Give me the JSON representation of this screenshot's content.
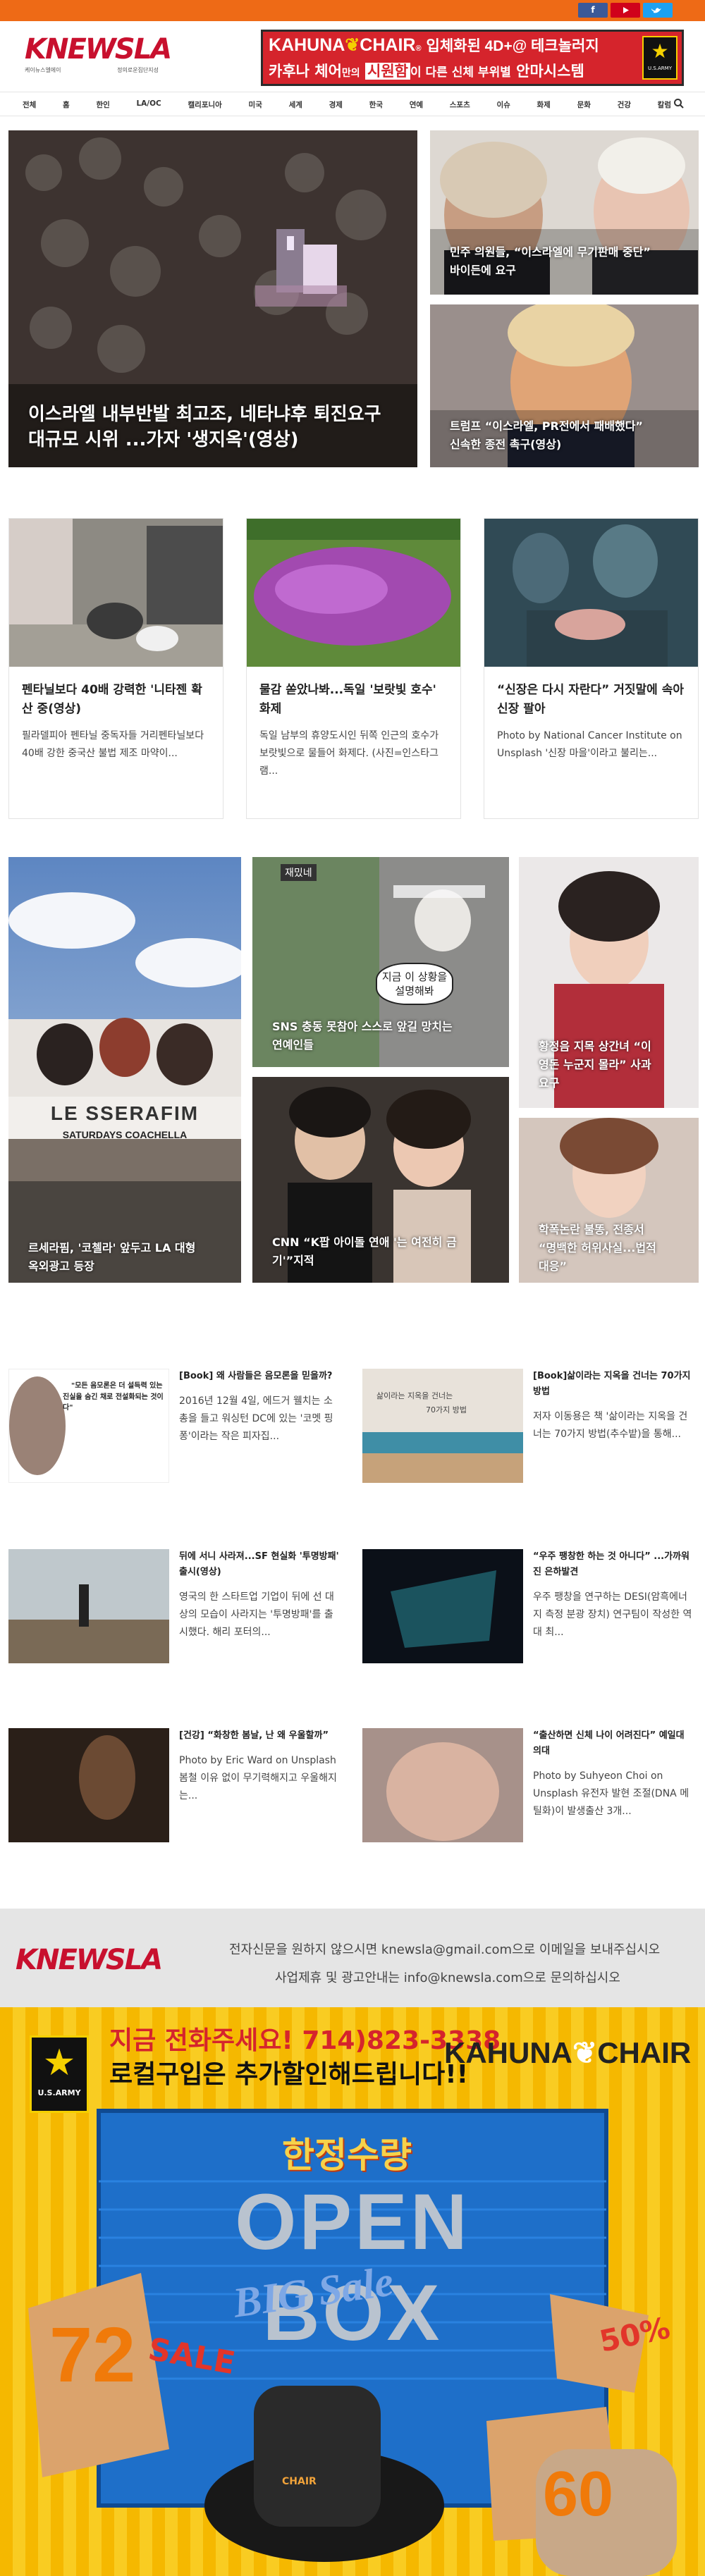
{
  "header": {
    "logo_text": "KNEWSLA",
    "logo_sub_left": "케이뉴스엘에이",
    "logo_sub_right": "정의로운집단지성",
    "ad": {
      "brand": "KAHUNA",
      "brand2": "CHAIR",
      "line1_tail": "입체화된 4D+@ 테크놀러지",
      "line2_a": "카후나 체어",
      "line2_b": "만의",
      "line2_c": "시원함",
      "line2_d": "이 다른 신체 부위별",
      "line2_e": "안마시스템",
      "army": "U.S.ARMY"
    }
  },
  "nav": {
    "items": [
      "전체",
      "홈",
      "한인",
      "LA/OC",
      "캘리포니아",
      "미국",
      "세계",
      "경제",
      "한국",
      "연예",
      "스포츠",
      "이슈",
      "화제",
      "문화",
      "건강",
      "칼럼"
    ]
  },
  "hero": {
    "main_title_1": "이스라엘 내부반발 최고조, 네타냐후 퇴진요구",
    "main_title_2": "대규모 시위 ...가자 '생지옥'(영상)",
    "side1_1": "민주 의원들, “이스라엘에 무기판매 중단”",
    "side1_2": "바이든에 요구",
    "side2_1": "트럼프 “이스라엘, PR전에서 패배했다”",
    "side2_2": "신속한 종전 촉구(영상)"
  },
  "cards": [
    {
      "title": "펜타닐보다 40배 강력한 '니타젠 확산 중(영상)",
      "excerpt": "필라델피아 펜타닐 중독자들 거리펜타닐보다 40배 강한 중국산 불법 제조 마약이..."
    },
    {
      "title": "물감 쏟았나봐...독일 '보랏빛 호수' 화제",
      "excerpt": "독일 남부의 휴양도시인 뒤쪽 인근의 호수가 보랏빛으로 물들어 화제다. (사진=인스타그램..."
    },
    {
      "title": "“신장은 다시 자란다” 거짓말에 속아 신장 팔아",
      "excerpt": "Photo by National Cancer Institute on Unsplash '신장 마을'이라고 불리는..."
    }
  ],
  "ent": {
    "left_1": "르세라핌, '코첼라' 앞두고 LA 대형",
    "left_2": "옥외광고 등장",
    "mid_top_1": "SNS 충동 못참아 스스로 앞길 망치는",
    "mid_top_2": "연예인들",
    "mid_bot_1": "CNN “K팝 아이돌 연애 '는 여전히 금",
    "mid_bot_2": "기'”지적",
    "right_top_1": "황정음 지목 상간녀 “이",
    "right_top_2": "영돈 누군지 몰라” 사과",
    "right_top_3": "요구",
    "right_bot_1": "학폭논란 불똥, 전종서",
    "right_bot_2": "“명백한 허위사실...법적",
    "right_bot_3": "대응”",
    "speech": "지금 이 상황을 설명해봐",
    "speech_top": "재밌네",
    "billboard_name": "LE SSERAFIM",
    "billboard_sub": "SATURDAYS  COACHELLA"
  },
  "list_items": [
    {
      "title": "[Book] 왜 사람들은 음모론을 믿을까?",
      "excerpt": "2016년 12월 4일, 에드거 웰치는 소총을 들고 워싱턴 DC에 있는 '코멧 핑퐁'이라는 작은 피자집...",
      "thumb_line1": "\"모든 음모론은 더 설득력 있는",
      "thumb_line2": "진실을 숨긴 채로 전설화되는 것이다\""
    },
    {
      "title": "[Book]삶이라는 지옥을 건너는 70가지 방법",
      "excerpt": "저자 이동용은 책 '삶이라는 지옥을 건너는 70가지 방법(추수밭)을 통해...",
      "thumb_line1": "삶이라는 지옥을 건너는",
      "thumb_line2": "70가지 방법"
    },
    {
      "title": "뒤에 서니 사라져...SF 현실화 '투명방패' 출시(영상)",
      "excerpt": "영국의 한 스타트업 기업이 뒤에 선 대상의 모습이 사라지는 '투명방패'를 출시했다. 해리 포터의..."
    },
    {
      "title": "“우주 팽창한 하는 것 아니다” ...가까워진 은하발견",
      "excerpt": "우주 팽창을 연구하는 DESI(암흑에너지 측정 분광 장치) 연구팀이 작성한 역대 최..."
    },
    {
      "title": "[건강] “화창한 봄날, 난 왜 우울할까”",
      "excerpt": "Photo by Eric Ward on Unsplash 봄철 이유 없이 무기력해지고 우울해지는..."
    },
    {
      "title": "“출산하면 신체 나이 어려진다” 예일대 의대",
      "excerpt": "Photo by Suhyeon Choi on Unsplash 유전자 발현 조절(DNA 메틸화)이 발생출산 3개..."
    }
  ],
  "footer": {
    "logo_text": "KNEWSLA",
    "line1": "전자신문을 원하지 않으시면 knewsla@gmail.com으로 이메일을 보내주십시오",
    "line2": "사업제휴 및 광고안내는 info@knewsla.com으로 문의하십시오"
  },
  "bottom_ad": {
    "headline1": "지금 전화주세요! 714)823-3338",
    "headline2": "로컬구입은 추가할인해드립니다!!",
    "brand": "KAHUNA",
    "brand2": "CHAIR",
    "army": "U.S.ARMY",
    "limited": "한정수량",
    "open_box": "OPEN BOX",
    "big_sale": "BIG Sale",
    "pct72": "72",
    "pct50": "50%",
    "pct60": "60",
    "sale": "SALE",
    "chair_label": "CHAIR"
  },
  "colors": {
    "accent": "#ee6a16",
    "brand_red": "#c8102e",
    "ad_red": "#d5242c",
    "army_green": "#2d3d2a"
  }
}
